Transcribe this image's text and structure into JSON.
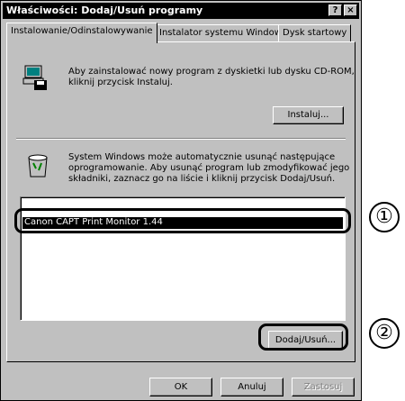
{
  "window": {
    "title": "Właściwości: Dodaj/Usuń programy",
    "help_label": "?",
    "close_label": "×"
  },
  "tabs": [
    {
      "label": "Instalowanie/Odinstalowywanie",
      "active": true
    },
    {
      "label": "Instalator systemu Windows",
      "active": false
    },
    {
      "label": "Dysk startowy",
      "active": false
    }
  ],
  "install_section": {
    "description_line1": "Aby zainstalować nowy program z dyskietki lub dysku CD-ROM,",
    "description_line2": "kliknij przycisk Instaluj.",
    "install_button": "Instaluj..."
  },
  "remove_section": {
    "description_line1": "System Windows może automatycznie usunąć następujące",
    "description_line2": "oprogramowanie. Aby usunąć program lub zmodyfikować jego",
    "description_line3": "składniki, zaznacz go na liście i kliknij przycisk Dodaj/Usuń.",
    "programs": [
      "Canon CAPT Print Monitor 1.44"
    ],
    "add_remove_button": "Dodaj/Usuń..."
  },
  "footer": {
    "ok_label": "OK",
    "cancel_label": "Anuluj",
    "apply_label": "Zastosuj"
  },
  "callouts": {
    "one": "①",
    "two": "②"
  }
}
